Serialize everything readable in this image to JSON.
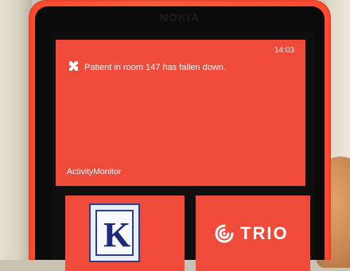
{
  "device": {
    "brand": "NOKIA"
  },
  "tiles": {
    "notification": {
      "time": "14:03",
      "message": "Patient in room 147 has fallen down.",
      "app_name": "ActivityMonitor",
      "icon": "puzzle-icon"
    },
    "k_app": {
      "icon": "k-logo-icon"
    },
    "trio_app": {
      "label": "TRIO",
      "icon": "trio-swirl-icon"
    }
  },
  "colors": {
    "tile_red": "#f04a3b",
    "phone_orange": "#ff5a3b",
    "k_blue": "#2e3d8f"
  }
}
